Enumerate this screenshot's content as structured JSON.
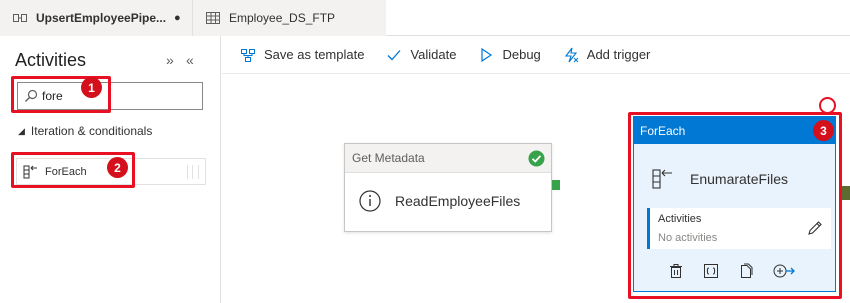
{
  "tabs": [
    {
      "label": "UpsertEmployeePipe...",
      "modified_marker": "●",
      "icon": "pipeline-icon"
    },
    {
      "label": "Employee_DS_FTP",
      "icon": "table-icon"
    }
  ],
  "activities_panel": {
    "title": "Activities",
    "collapse_glyph": "»",
    "minimize_glyph": "«",
    "search": {
      "value": "fore",
      "placeholder": ""
    },
    "group_label": "Iteration & conditionals",
    "items": [
      {
        "label": "ForEach",
        "icon": "foreach-icon"
      }
    ]
  },
  "toolbar": {
    "save_template": "Save as template",
    "validate": "Validate",
    "debug": "Debug",
    "add_trigger": "Add trigger"
  },
  "canvas": {
    "get_metadata": {
      "header": "Get Metadata",
      "name": "ReadEmployeeFiles",
      "status": "success"
    },
    "foreach": {
      "header": "ForEach",
      "name": "EnumarateFiles",
      "activities_label": "Activities",
      "activities_value": "No activities"
    }
  },
  "callouts": [
    "1",
    "2",
    "3"
  ],
  "colors": {
    "accent": "#0078d4",
    "callout_red": "#e81123",
    "success_green": "#36a24a"
  }
}
